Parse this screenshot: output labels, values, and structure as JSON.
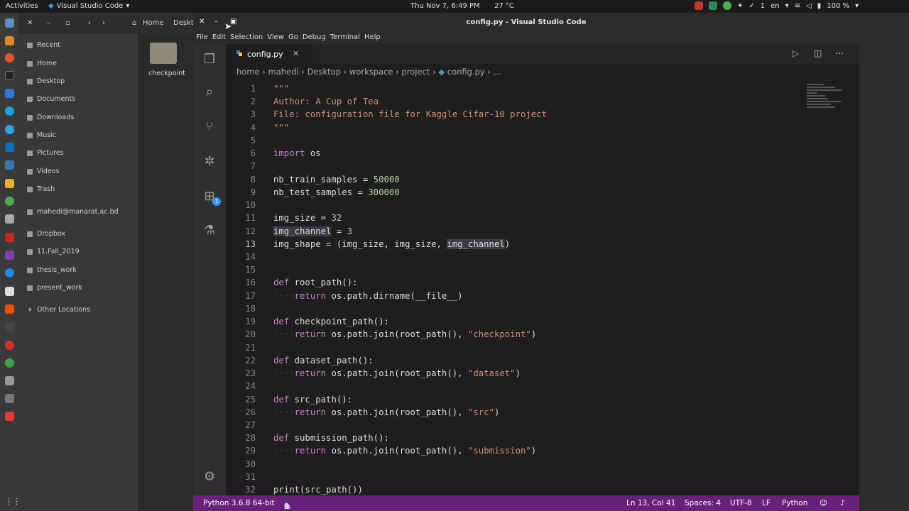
{
  "topbar": {
    "activities": "Activities",
    "app_name": "Visual Studio Code",
    "clock": "Thu Nov  7,  6:49 PM",
    "temperature": "27 °C",
    "lang": "en",
    "badge_count": "1",
    "battery": "100 %"
  },
  "files": {
    "nav": {
      "home": "Home",
      "desktop": "Deskt"
    },
    "sidebar": [
      "Recent",
      "Home",
      "Desktop",
      "Documents",
      "Downloads",
      "Music",
      "Pictures",
      "Videos",
      "Trash",
      "mahedi@manarat.ac.bd",
      "Dropbox",
      "11.Fall_2019",
      "thesis_work",
      "present_work",
      "Other Locations"
    ],
    "folder_label": "checkpoint"
  },
  "vscode": {
    "title": "config.py - Visual Studio Code",
    "menu": [
      "File",
      "Edit",
      "Selection",
      "View",
      "Go",
      "Debug",
      "Terminal",
      "Help"
    ],
    "tab": "config.py",
    "breadcrumb": [
      "home",
      "mahedi",
      "Desktop",
      "workspace",
      "project",
      "config.py",
      "…"
    ],
    "extensions_badge": "1",
    "status": {
      "python": "Python 3.6.8 64-bit",
      "errors": "0",
      "warnings": "0",
      "position": "Ln 13, Col 41",
      "spaces": "Spaces: 4",
      "encoding": "UTF-8",
      "eol": "LF",
      "language": "Python"
    },
    "cursor_line": 13
  },
  "code": [
    "\"\"\"",
    "Author: A Cup of Tea",
    "File: configuration file for Kaggle Cifar-10 project",
    "\"\"\"",
    "",
    "import os",
    "",
    "nb_train_samples = 50000",
    "nb_test_samples = 300000",
    "",
    "img_size = 32",
    "img_channel = 3",
    "img_shape = (img_size, img_size, img_channel)",
    "",
    "",
    "def root_path():",
    "    return os.path.dirname(__file__)",
    "",
    "def checkpoint_path():",
    "    return os.path.join(root_path(), \"checkpoint\")",
    "",
    "def dataset_path():",
    "    return os.path.join(root_path(), \"dataset\")",
    "",
    "def src_path():",
    "    return os.path.join(root_path(), \"src\")",
    "",
    "def submission_path():",
    "    return os.path.join(root_path(), \"submission\")",
    "",
    "",
    "print(src_path())"
  ]
}
